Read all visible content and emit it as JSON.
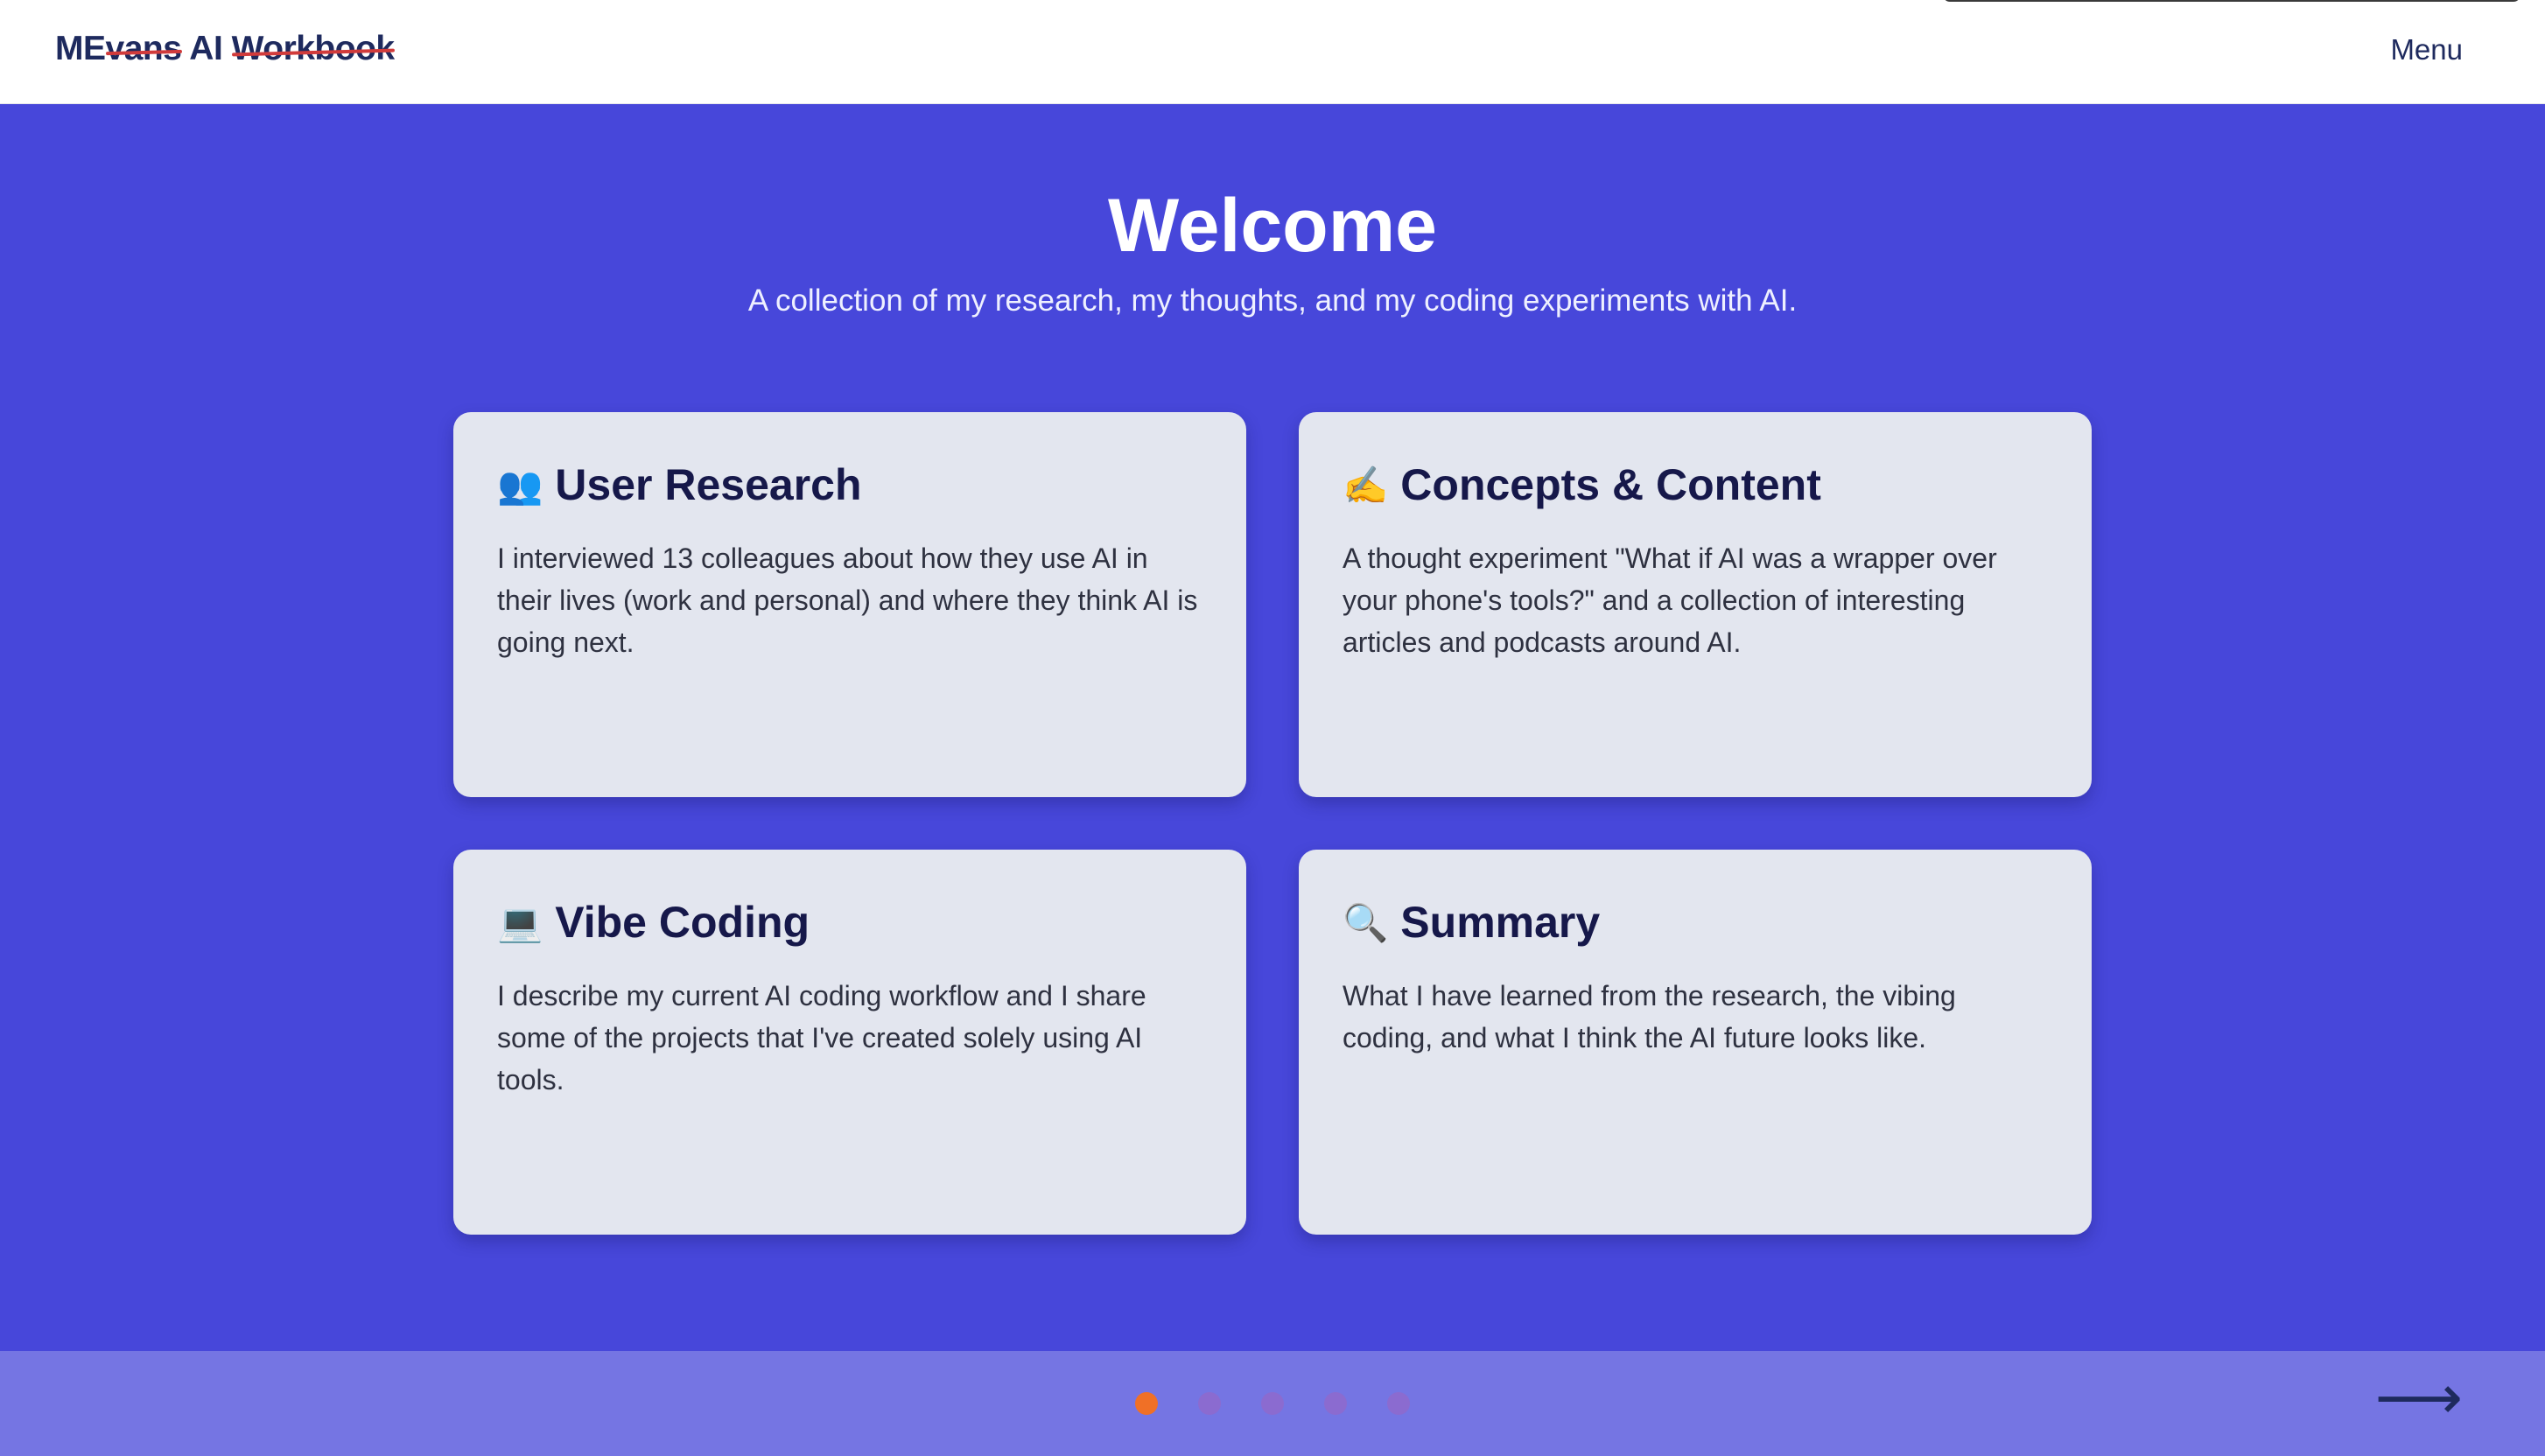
{
  "header": {
    "logo_prefix": "ME",
    "logo_strike1": "vans",
    "logo_middle": " AI ",
    "logo_strike2": "Workbook",
    "menu_label": "Menu"
  },
  "hero": {
    "title": "Welcome",
    "subtitle": "A collection of my research, my thoughts, and my coding experiments with AI."
  },
  "cards": [
    {
      "icon": "👥",
      "icon_name": "users-icon",
      "title": "User Research",
      "body": "I interviewed 13 colleagues about how they use AI in their lives (work and personal) and where they think AI is going next."
    },
    {
      "icon": "✍️",
      "icon_name": "writing-hand-icon",
      "title": "Concepts & Content",
      "body": "A thought experiment \"What if AI was a wrapper over your phone's tools?\" and a collection of interesting articles and podcasts around AI."
    },
    {
      "icon": "💻",
      "icon_name": "laptop-icon",
      "title": "Vibe Coding",
      "body": "I describe my current AI coding workflow and I share some of the projects that I've created solely using AI tools."
    },
    {
      "icon": "🔍",
      "icon_name": "magnifier-icon",
      "title": "Summary",
      "body": "What I have learned from the research, the vibing coding, and what I think the AI future looks like."
    }
  ],
  "footer": {
    "slides_total": 5,
    "active_slide": 1,
    "next_arrow": "⟶"
  },
  "colors": {
    "hero_bg": "#4747da",
    "footer_bg": "#7575e3",
    "card_bg": "#e3e6ef",
    "active_dot": "#f07026",
    "inactive_dot": "#8b6bd0",
    "logo_strike": "#d13b3b"
  }
}
